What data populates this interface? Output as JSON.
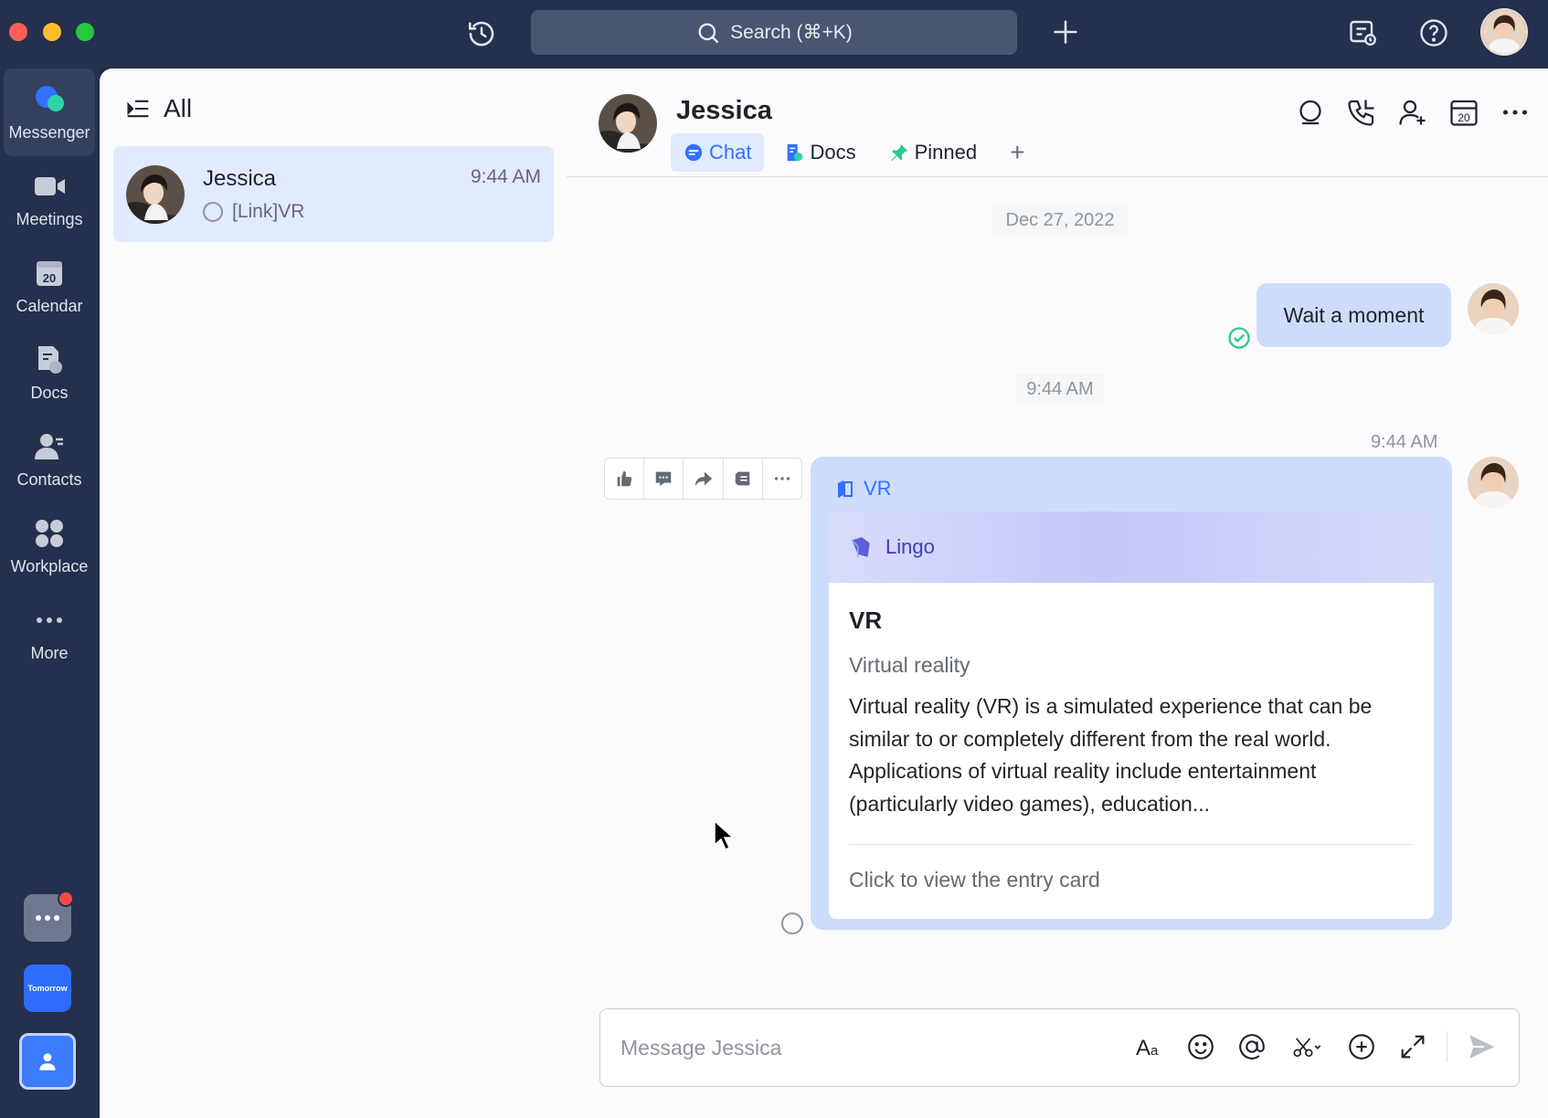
{
  "titlebar": {
    "search_placeholder": "Search (⌘+K)"
  },
  "rail": {
    "items": [
      {
        "label": "Messenger",
        "icon": "messenger-icon"
      },
      {
        "label": "Meetings",
        "icon": "video-camera-icon"
      },
      {
        "label": "Calendar",
        "icon": "calendar-icon",
        "day": "20"
      },
      {
        "label": "Docs",
        "icon": "docs-icon"
      },
      {
        "label": "Contacts",
        "icon": "contacts-icon"
      },
      {
        "label": "Workplace",
        "icon": "workplace-icon"
      },
      {
        "label": "More",
        "icon": "more-dots-icon"
      }
    ],
    "tomorrow_label": "Tomorrow"
  },
  "list": {
    "header": "All",
    "conversations": [
      {
        "name": "Jessica",
        "time": "9:44 AM",
        "preview": "[Link]VR"
      }
    ]
  },
  "chat": {
    "name": "Jessica",
    "tabs": [
      {
        "label": "Chat",
        "icon": "chat-bubble-icon"
      },
      {
        "label": "Docs",
        "icon": "doc-icon"
      },
      {
        "label": "Pinned",
        "icon": "pin-icon"
      }
    ],
    "calendar_day": "20",
    "date_divider": "Dec 27, 2022",
    "messages": [
      {
        "text": "Wait a moment"
      }
    ],
    "time_divider": "9:44 AM",
    "card": {
      "time": "9:44 AM",
      "title": "VR",
      "source": "Lingo",
      "term": "VR",
      "full_name": "Virtual reality",
      "description": "Virtual reality (VR) is a simulated experience that can be similar to or completely different from the real world. Applications of virtual reality include entertainment (particularly video games), education...",
      "link": "Click to view the entry card"
    },
    "composer_placeholder": "Message Jessica"
  },
  "colors": {
    "accent": "#3370ff",
    "bubble": "#cedcfc",
    "rail_bg": "#24304d"
  }
}
